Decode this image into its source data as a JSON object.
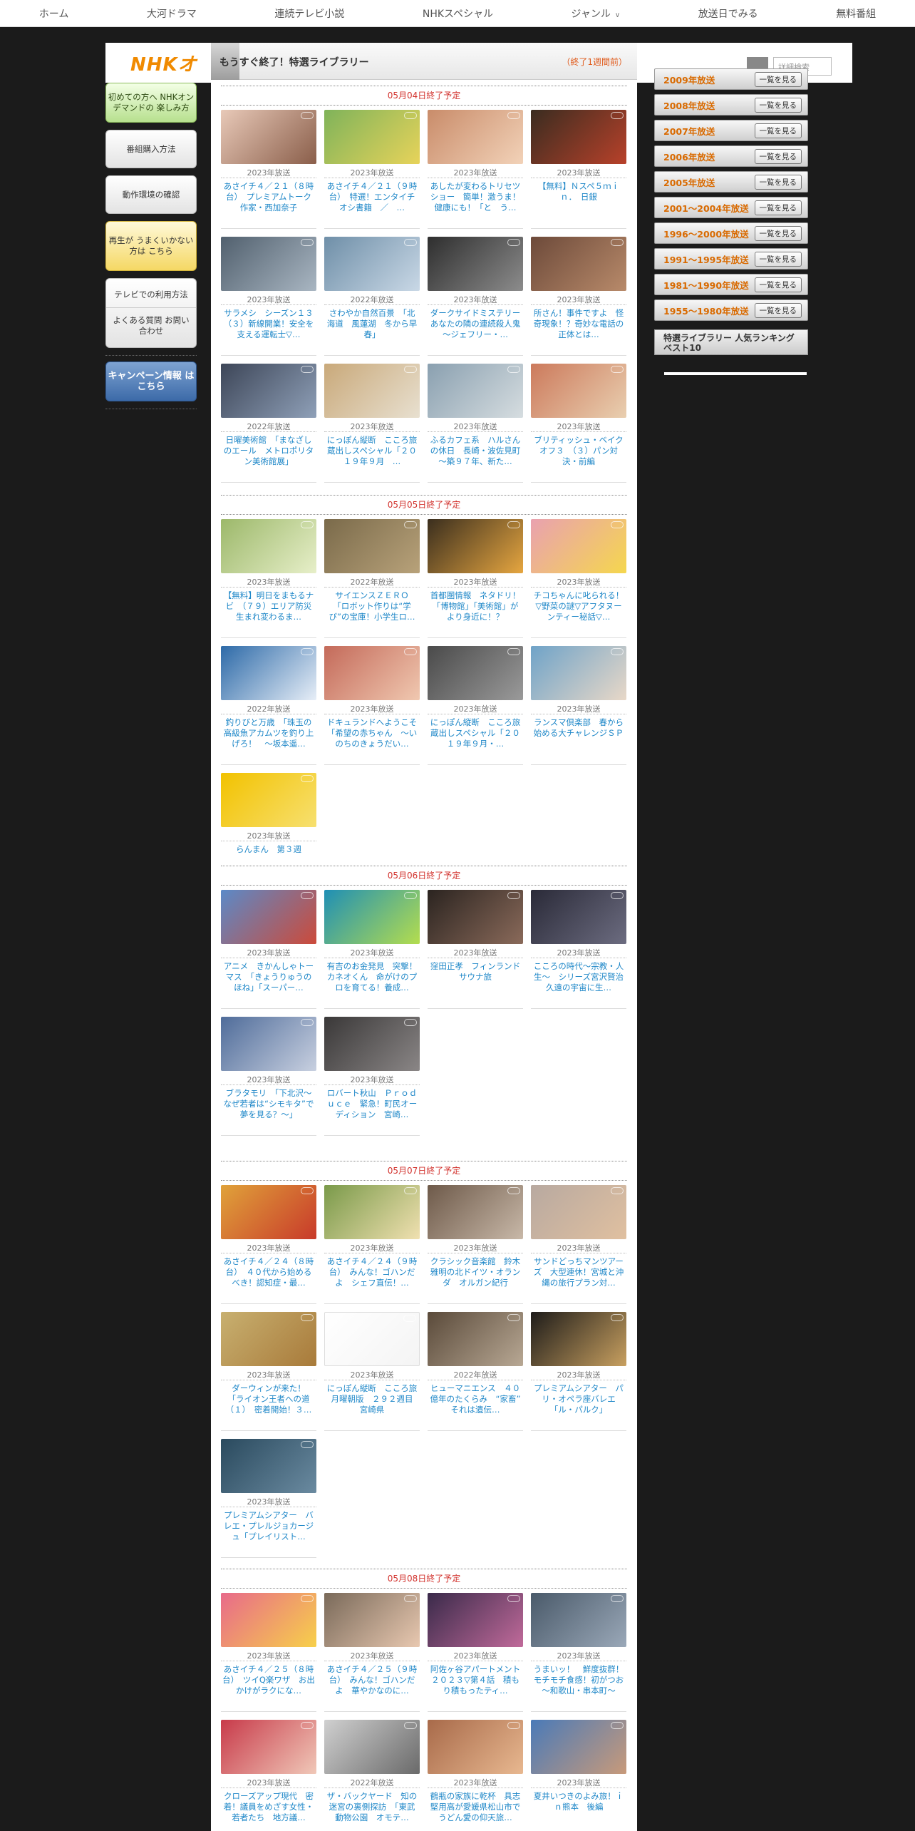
{
  "nav": [
    "ホーム",
    "大河ドラマ",
    "連続テレビ小説",
    "NHKスペシャル",
    "ジャンル",
    "放送日でみる",
    "無料番組"
  ],
  "brand": {
    "logo_text": "NHKオ"
  },
  "search": {
    "placeholder": "詳細検索"
  },
  "sidebar": {
    "items": [
      "初めての方へ NHKオンデマンドの 楽しみ方",
      "番組購入方法",
      "動作環境の確認",
      "再生が うまくいかない方は こちら",
      "テレビでの利用方法",
      "よくある質問 お問い合わせ",
      "キャンペーン情報 はこちら"
    ]
  },
  "main": {
    "title": "もうすぐ終了！特選ライブラリー",
    "subtitle": "（終了1週間前）",
    "sections": [
      {
        "heading": "05月04日終了予定",
        "items": [
          {
            "year": "2023年放送",
            "title": "あさイチ４／２１（８時台）　プレミアムトーク　作家・西加奈子"
          },
          {
            "year": "2023年放送",
            "title": "あさイチ４／２１（９時台）　特選！エンタイチオシ書籍　／　…"
          },
          {
            "year": "2023年放送",
            "title": "あしたが変わるトリセツショー　簡単！激うま！健康にも！「と　う…"
          },
          {
            "year": "2023年放送",
            "title": "【無料】Ｎスペ５ｍｉｎ．　日銀"
          },
          {
            "year": "2023年放送",
            "title": "サラメシ　シーズン１３　（３）新線開業！安全を支える運転士▽…"
          },
          {
            "year": "2022年放送",
            "title": "さわやか自然百景　「北海道　風蓮湖　冬から早春」"
          },
          {
            "year": "2023年放送",
            "title": "ダークサイドミステリー　あなたの隣の連続殺人鬼～ジェフリー・…"
          },
          {
            "year": "2023年放送",
            "title": "所さん！事件ですよ　怪奇現象！？奇妙な電話の正体とは…"
          },
          {
            "year": "2022年放送",
            "title": "日曜美術館　「まなざしのエール　メトロポリタン美術館展」"
          },
          {
            "year": "2023年放送",
            "title": "にっぽん縦断　こころ旅　蔵出しスペシャル「２０１９年９月　…"
          },
          {
            "year": "2023年放送",
            "title": "ふるカフェ系　ハルさんの休日　長崎・波佐見町～築９７年、新た…"
          },
          {
            "year": "2023年放送",
            "title": "ブリティッシュ・ベイクオフ３　（３）パン対決・前編"
          }
        ]
      },
      {
        "heading": "05月05日終了予定",
        "items": [
          {
            "year": "2023年放送",
            "title": "【無料】明日をまもるナビ　（７９）エリア防災　生まれ変わるま…"
          },
          {
            "year": "2022年放送",
            "title": "サイエンスＺＥＲＯ　「ロボット作りは“学び”の宝庫！小学生ロ…"
          },
          {
            "year": "2023年放送",
            "title": "首都圏情報　ネタドリ！　「博物館」「美術館」がより身近に！？"
          },
          {
            "year": "2023年放送",
            "title": "チコちゃんに叱られる！　▽野菜の謎▽アフタヌーンティー秘話▽…"
          },
          {
            "year": "2022年放送",
            "title": "釣りびと万歳　「珠玉の高級魚アカムツを釣り上げろ！　～坂本遥…"
          },
          {
            "year": "2023年放送",
            "title": "ドキュランドへようこそ　「希望の赤ちゃん　～いのちのきょうだい…"
          },
          {
            "year": "2023年放送",
            "title": "にっぽん縦断　こころ旅　蔵出しスペシャル「２０１９年９月・…"
          },
          {
            "year": "2023年放送",
            "title": "ランスマ倶楽部　春から始める大チャレンジＳＰ"
          },
          {
            "year": "2023年放送",
            "title": "らんまん　第３週"
          }
        ]
      },
      {
        "heading": "05月06日終了予定",
        "items": [
          {
            "year": "2023年放送",
            "title": "アニメ　きかんしゃトーマス　「きょうりゅうのほね」「スーパー…"
          },
          {
            "year": "2023年放送",
            "title": "有吉のお金発見　突撃！カネオくん　命がけのプロを育てる！養成…"
          },
          {
            "year": "2023年放送",
            "title": "窪田正孝　フィンランド　サウナ旅"
          },
          {
            "year": "2023年放送",
            "title": "こころの時代～宗教・人生～　シリーズ宮沢賢治　久遠の宇宙に生…"
          },
          {
            "year": "2023年放送",
            "title": "ブラタモリ　「下北沢～なぜ若者は“シモキタ”で夢を見る？～」"
          },
          {
            "year": "2023年放送",
            "title": "ロバート秋山　Ｐｒｏｄｕｃｅ　緊急！町民オーディション　宮崎…"
          }
        ]
      },
      {
        "heading": "05月07日終了予定",
        "items": [
          {
            "year": "2023年放送",
            "title": "あさイチ４／２４（８時台）　４０代から始めるべき！認知症・最…"
          },
          {
            "year": "2023年放送",
            "title": "あさイチ４／２４（９時台）　みんな！ゴハンだよ　シェフ直伝！…"
          },
          {
            "year": "2023年放送",
            "title": "クラシック音楽館　鈴木雅明の北ドイツ・オランダ　オルガン紀行"
          },
          {
            "year": "2023年放送",
            "title": "サンドどっちマンツアーズ　大型連休！宮城と沖縄の旅行プラン対…"
          },
          {
            "year": "2023年放送",
            "title": "ダーウィンが来た！　「ライオン王者への道（１）　密着開始！３…"
          },
          {
            "year": "2023年放送",
            "title": "にっぽん縦断　こころ旅　月曜朝版　２９２週目　宮崎県"
          },
          {
            "year": "2022年放送",
            "title": "ヒューマニエンス　４０億年のたくらみ　“家畜”　それは遺伝…"
          },
          {
            "year": "2023年放送",
            "title": "プレミアムシアター　パリ・オペラ座バレエ「ル・パルク」"
          },
          {
            "year": "2023年放送",
            "title": "プレミアムシアター　バレエ・プレルジョカージュ「プレイリスト…"
          }
        ]
      },
      {
        "heading": "05月08日終了予定",
        "items": [
          {
            "year": "2023年放送",
            "title": "あさイチ４／２５（８時台）　ツイQ楽ワザ　お出かけがラクにな…"
          },
          {
            "year": "2023年放送",
            "title": "あさイチ４／２５（９時台）　みんな！ゴハンだよ　華やかなのに…"
          },
          {
            "year": "2023年放送",
            "title": "阿佐ヶ谷アパートメント　２０２３▽第４話　積もり積もったティ…"
          },
          {
            "year": "2023年放送",
            "title": "うまいッ！　鮮度抜群！モチモチ食感！初がつお～和歌山・串本町～"
          },
          {
            "year": "2023年放送",
            "title": "クローズアップ現代　密着！議員をめざす女性・若者たち　地方議…"
          },
          {
            "year": "2022年放送",
            "title": "ザ・バックヤード　知の迷宮の裏側探訪　「東武動物公園　オモテ…"
          },
          {
            "year": "2023年放送",
            "title": "鶴瓶の家族に乾杯　具志堅用高が愛媛県松山市でうどん愛の仰天旅…"
          },
          {
            "year": "2023年放送",
            "title": "夏井いつきのよみ旅！ｉｎ熊本　後編"
          }
        ]
      }
    ]
  },
  "right": {
    "years": [
      "2009年放送",
      "2008年放送",
      "2007年放送",
      "2006年放送",
      "2005年放送",
      "2001～2004年放送",
      "1996～2000年放送",
      "1991～1995年放送",
      "1981～1990年放送",
      "1955～1980年放送"
    ],
    "see_all": "一覧を見る",
    "ranking": "特選ライブラリー 人気ランキングベスト10"
  }
}
